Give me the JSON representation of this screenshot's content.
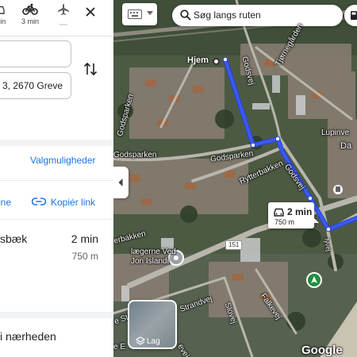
{
  "travel_modes": {
    "car_time": "min",
    "bike_time": "3 min"
  },
  "directions": {
    "origin_value": "",
    "destination_value": "3, 2670 Greve",
    "options_label": "Valgmuligheder",
    "send_label": "one",
    "copy_link_label": "Kopiér link"
  },
  "route": {
    "name": "sbæk",
    "time": "2 min",
    "distance": "750 m"
  },
  "nearby_label": "i nærheden",
  "map": {
    "search_placeholder": "Søg langs ruten",
    "home_label": "Hjem",
    "route_card_time": "2 min",
    "route_card_distance": "750 m",
    "road_number": "151",
    "layers_label": "Lag",
    "attribution": "Google",
    "route_color": "#3a5bf0",
    "street_labels": {
      "godsvej_north": "Godsvej",
      "tjornegarden": "Tjørnegården",
      "godsparken_v": "Godsparken",
      "godsparken_nw": "Godsparken",
      "godsparken_mid": "Godsparken",
      "rytterbakken": "Rytterbakken",
      "godsvej_south": "Godsvej",
      "lupinvej": "Lupinve",
      "da": "Da",
      "erbakken": "erbakken",
      "laegerne": "lægerne Ved",
      "jon_island": "Jon Islandi",
      "strandvej": "e Strandvej",
      "strandvej2": "Strandvej",
      "slovej": "Slovej",
      "falkevej": "Falkevej",
      "kl_e": "e E",
      "eve": "evej",
      "lyvej": "lyvej"
    }
  }
}
